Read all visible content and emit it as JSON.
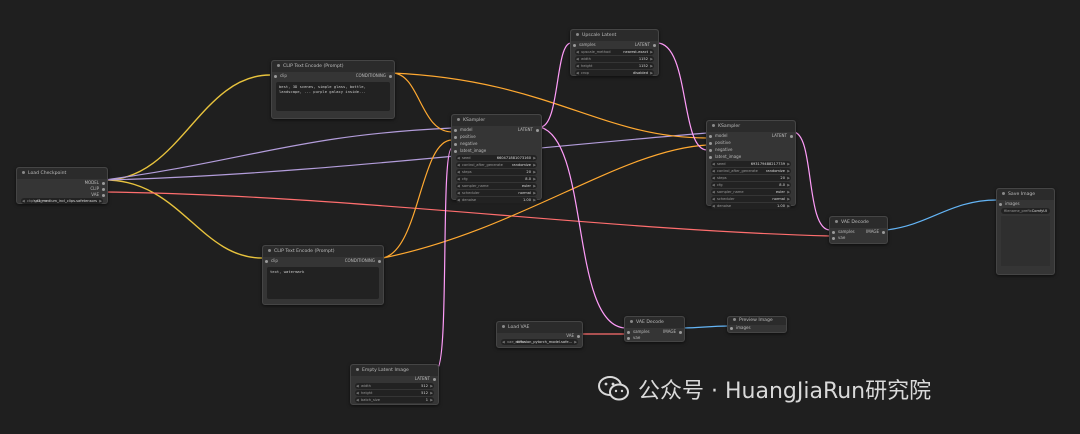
{
  "nodes": {
    "load_checkpoint": {
      "title": "Load Checkpoint",
      "outputs": [
        "MODEL",
        "CLIP",
        "VAE"
      ],
      "widgets": [
        {
          "label": "ckpt_name",
          "value": "sd3_medium_incl_clips.safetensors"
        }
      ]
    },
    "clip_pos": {
      "title": "CLIP Text Encode (Prompt)",
      "input": "clip",
      "output": "CONDITIONING",
      "text": "best, 3D scenes, simple glass, bottle, landscape, ... purple galaxy inside..."
    },
    "clip_neg": {
      "title": "CLIP Text Encode (Prompt)",
      "input": "clip",
      "output": "CONDITIONING",
      "text": "text, watermark"
    },
    "ksampler1": {
      "title": "KSampler",
      "inputs": [
        "model",
        "positive",
        "negative",
        "latent_image"
      ],
      "output": "LATENT",
      "widgets": [
        {
          "label": "seed",
          "value": "660471881073160"
        },
        {
          "label": "control_after_generate",
          "value": "randomize"
        },
        {
          "label": "steps",
          "value": "20"
        },
        {
          "label": "cfg",
          "value": "8.0"
        },
        {
          "label": "sampler_name",
          "value": "euler"
        },
        {
          "label": "scheduler",
          "value": "normal"
        },
        {
          "label": "denoise",
          "value": "1.00"
        }
      ]
    },
    "upscale_latent": {
      "title": "Upscale Latent",
      "input": "samples",
      "output": "LATENT",
      "widgets": [
        {
          "label": "upscale_method",
          "value": "nearest-exact"
        },
        {
          "label": "width",
          "value": "1152"
        },
        {
          "label": "height",
          "value": "1152"
        },
        {
          "label": "crop",
          "value": "disabled"
        }
      ]
    },
    "ksampler2": {
      "title": "KSampler",
      "inputs": [
        "model",
        "positive",
        "negative",
        "latent_image"
      ],
      "output": "LATENT",
      "widgets": [
        {
          "label": "seed",
          "value": "693179488217739"
        },
        {
          "label": "control_after_generate",
          "value": "randomize"
        },
        {
          "label": "steps",
          "value": "20"
        },
        {
          "label": "cfg",
          "value": "8.0"
        },
        {
          "label": "sampler_name",
          "value": "euler"
        },
        {
          "label": "scheduler",
          "value": "normal"
        },
        {
          "label": "denoise",
          "value": "1.00"
        }
      ]
    },
    "vae_decode1": {
      "title": "VAE Decode",
      "inputs": [
        "samples",
        "vae"
      ],
      "output": "IMAGE"
    },
    "save_image": {
      "title": "Save Image",
      "input": "images",
      "widgets": [
        {
          "label": "filename_prefix",
          "value": "ComfyUI"
        }
      ]
    },
    "load_vae": {
      "title": "Load VAE",
      "output": "VAE",
      "widgets": [
        {
          "label": "vae_name",
          "value": "diffusion_pytorch_model.safe..."
        }
      ]
    },
    "vae_decode2": {
      "title": "VAE Decode",
      "inputs": [
        "samples",
        "vae"
      ],
      "output": "IMAGE"
    },
    "preview_image": {
      "title": "Preview Image",
      "input": "images"
    },
    "empty_latent": {
      "title": "Empty Latent Image",
      "output": "LATENT",
      "widgets": [
        {
          "label": "width",
          "value": "512"
        },
        {
          "label": "height",
          "value": "512"
        },
        {
          "label": "batch_size",
          "value": "1"
        }
      ]
    }
  },
  "colors": {
    "background": "#1f1f1f",
    "clip_wire": "#e8c33d",
    "model_wire": "#b39ddb",
    "vae_wire": "#ff6e6e",
    "latent_wire": "#ff9cf9",
    "conditioning_wire": "#ffa931",
    "image_wire": "#64b5f6"
  },
  "watermark": {
    "text": "公众号 · HuangJiaRun研究院",
    "icon": "wechat-icon"
  }
}
